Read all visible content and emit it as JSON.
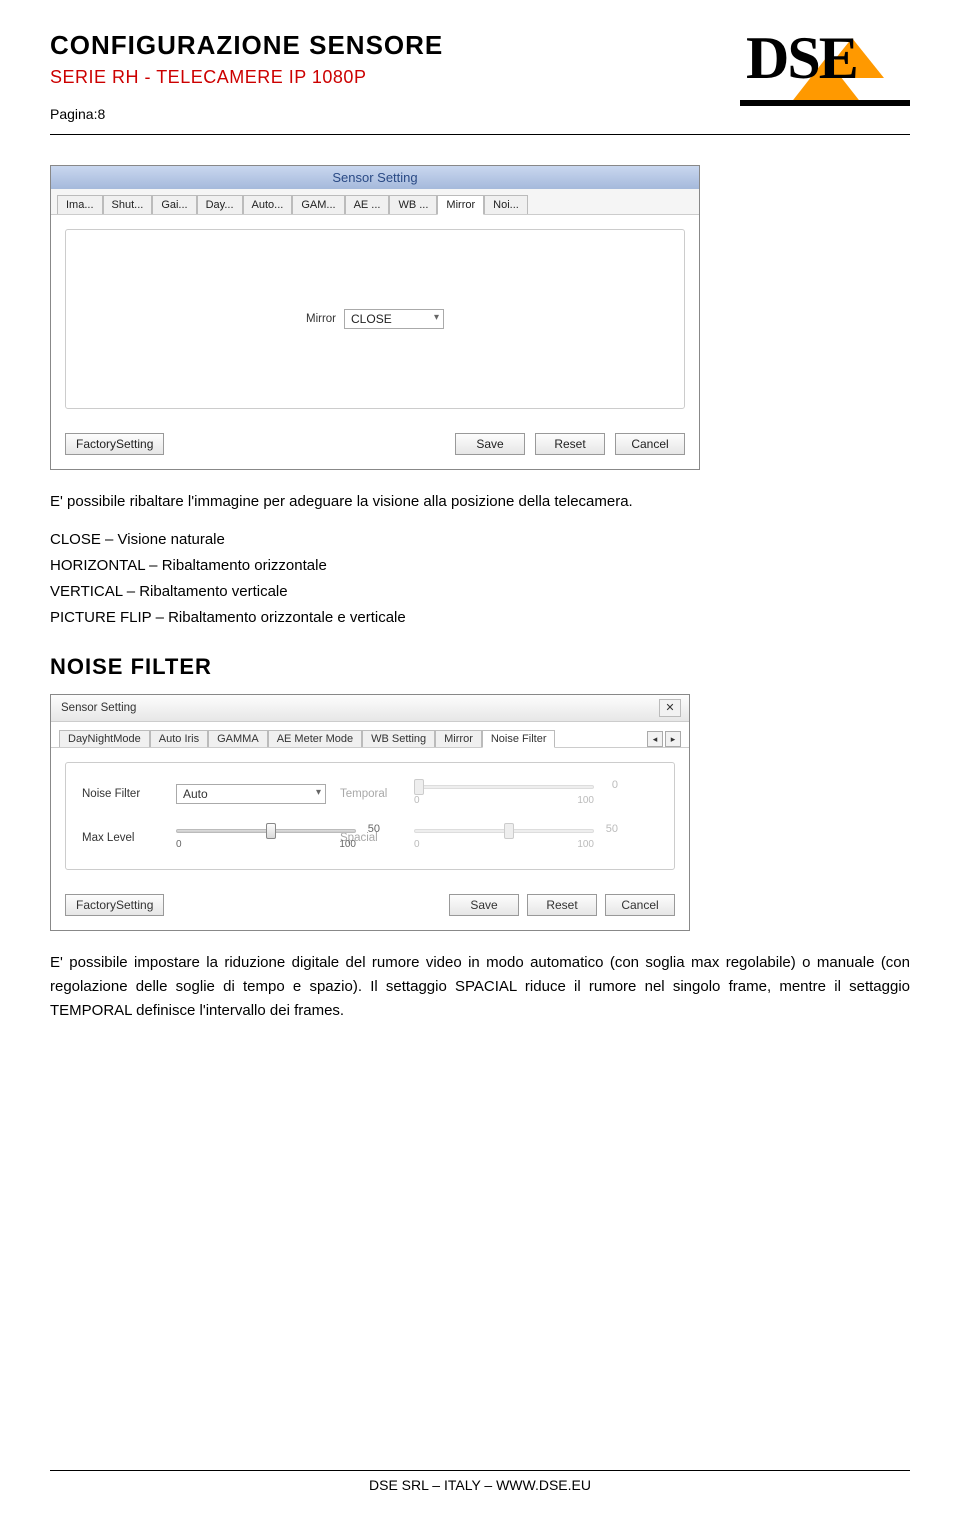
{
  "doc": {
    "title": "CONFIGURAZIONE SENSORE",
    "subtitle": "SERIE RH - TELECAMERE IP 1080P",
    "page_label": "Pagina",
    "page_num": "8"
  },
  "logo_text": "DSE",
  "screenshot1": {
    "title": "Sensor Setting",
    "tabs": [
      "Ima...",
      "Shut...",
      "Gai...",
      "Day...",
      "Auto...",
      "GAM...",
      "AE ...",
      "WB ...",
      "Mirror",
      "Noi..."
    ],
    "active_tab_index": 8,
    "field_label": "Mirror",
    "field_value": "CLOSE",
    "buttons": {
      "factory": "FactorySetting",
      "save": "Save",
      "reset": "Reset",
      "cancel": "Cancel"
    }
  },
  "para1": "E' possibile ribaltare l'immagine per adeguare la visione alla posizione della telecamera.",
  "kv": [
    {
      "k": "CLOSE",
      "v": " – Visione naturale"
    },
    {
      "k": "HORIZONTAL",
      "v": "  – Ribaltamento orizzontale"
    },
    {
      "k": "VERTICAL",
      "v": " – Ribaltamento verticale"
    },
    {
      "k": "PICTURE FLIP",
      "v": " – Ribaltamento orizzontale e verticale"
    }
  ],
  "section_h": "NOISE FILTER",
  "screenshot2": {
    "title": "Sensor Setting",
    "tabs": [
      "DayNightMode",
      "Auto Iris",
      "GAMMA",
      "AE Meter Mode",
      "WB Setting",
      "Mirror",
      "Noise Filter"
    ],
    "active_tab_index": 6,
    "labels": {
      "noise_filter": "Noise Filter",
      "max_level": "Max Level",
      "temporal": "Temporal",
      "spacial": "Spacial"
    },
    "noise_filter_value": "Auto",
    "max_level": {
      "value": "50",
      "min": "0",
      "max": "100",
      "pos_pct": 50
    },
    "temporal": {
      "value": "0",
      "min": "0",
      "max": "100",
      "pos_pct": 0,
      "disabled": true
    },
    "spacial": {
      "value": "50",
      "min": "0",
      "max": "100",
      "pos_pct": 50,
      "disabled": true
    },
    "buttons": {
      "factory": "FactorySetting",
      "save": "Save",
      "reset": "Reset",
      "cancel": "Cancel"
    }
  },
  "para2": "E' possibile impostare la riduzione digitale del rumore video in modo automatico (con soglia max regolabile) o manuale (con regolazione delle soglie di tempo e spazio). Il settaggio SPACIAL riduce il rumore nel singolo frame, mentre il settaggio TEMPORAL definisce l'intervallo dei frames.",
  "footer": "DSE SRL – ITALY – WWW.DSE.EU"
}
